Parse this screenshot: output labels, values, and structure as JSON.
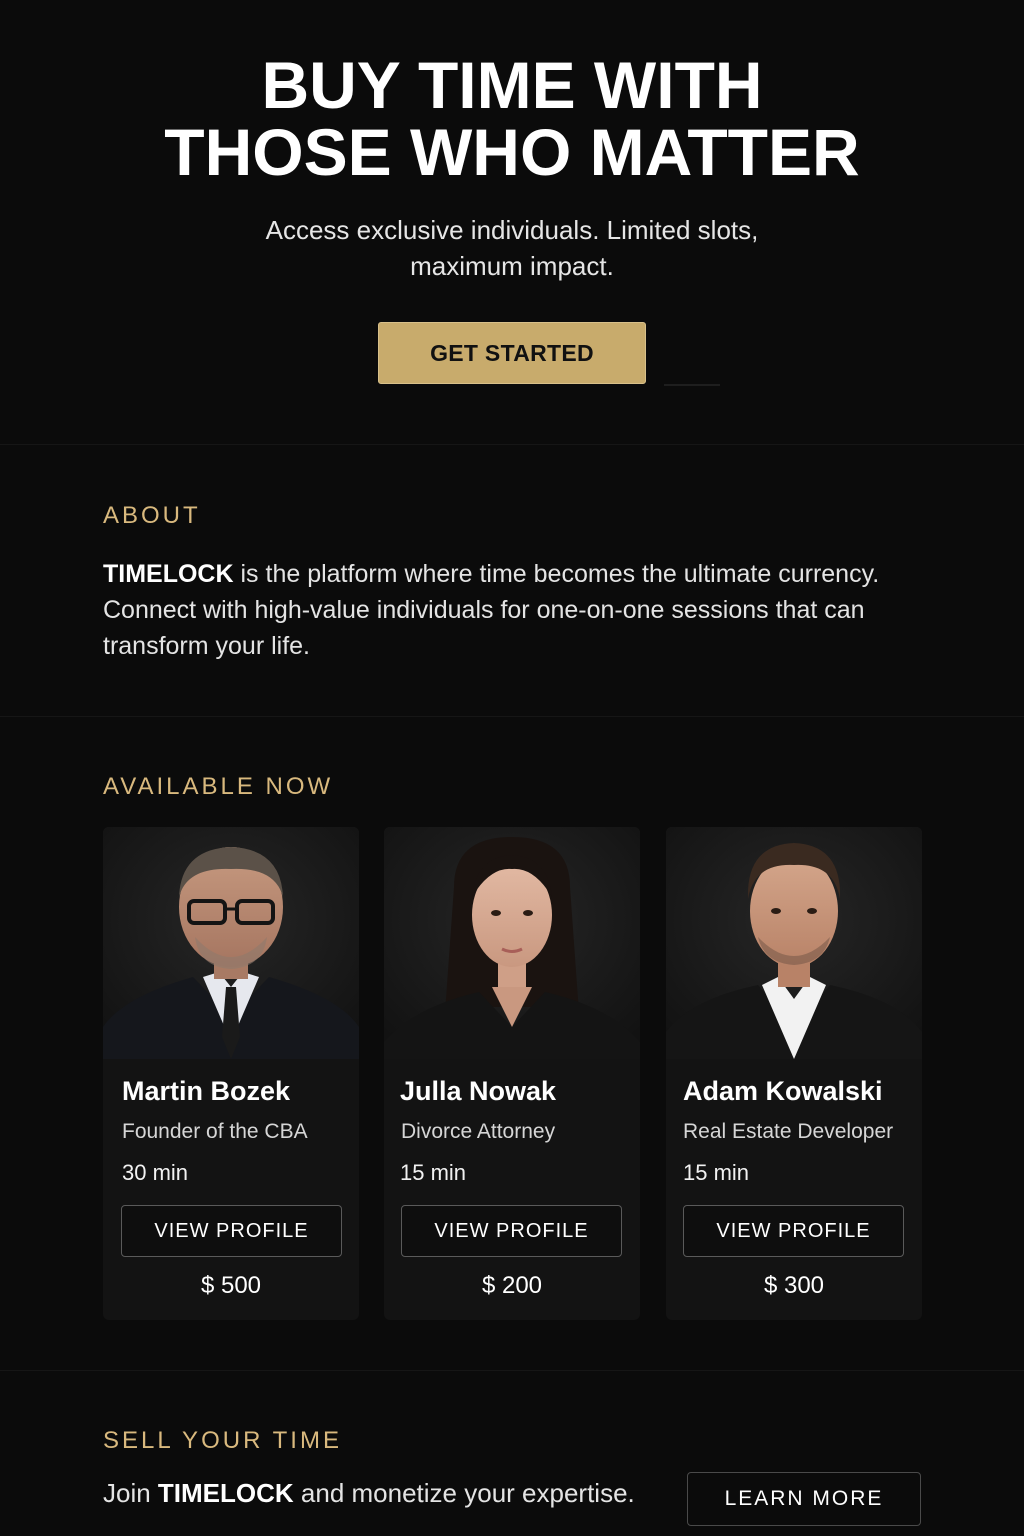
{
  "hero": {
    "title_line1": "BUY TIME WITH",
    "title_line2": "THOSE WHO MATTER",
    "subtitle_line1": "Access exclusive individuals. Limited slots,",
    "subtitle_line2": "maximum impact.",
    "cta_label": "GET STARTED"
  },
  "about": {
    "label": "ABOUT",
    "brand": "TIMELOCK",
    "text": " is the platform where time becomes the ultimate currency. Connect with high-value individuals for one-on-one sessions that can transform your life."
  },
  "available": {
    "label": "AVAILABLE NOW",
    "profiles": [
      {
        "name": "Martin Bozek",
        "role": "Founder of the CBA",
        "duration": "30 min",
        "button": "VIEW PROFILE",
        "price": "$ 500"
      },
      {
        "name": "Julla Nowak",
        "role": "Divorce Attorney",
        "duration": "15 min",
        "button": "VIEW PROFILE",
        "price": "$ 200"
      },
      {
        "name": "Adam Kowalski",
        "role": "Real Estate Developer",
        "duration": "15 min",
        "button": "VIEW PROFILE",
        "price": "$ 300"
      }
    ]
  },
  "sell": {
    "label": "SELL YOUR TIME",
    "text_prefix": "Join ",
    "brand": "TIMELOCK",
    "text_suffix": " and monetize your expertise.",
    "button": "LEARN MORE"
  },
  "colors": {
    "background": "#0b0b0b",
    "accent_gold": "#d9b97e",
    "cta_gold": "#c8ab6c",
    "card": "#131313"
  }
}
